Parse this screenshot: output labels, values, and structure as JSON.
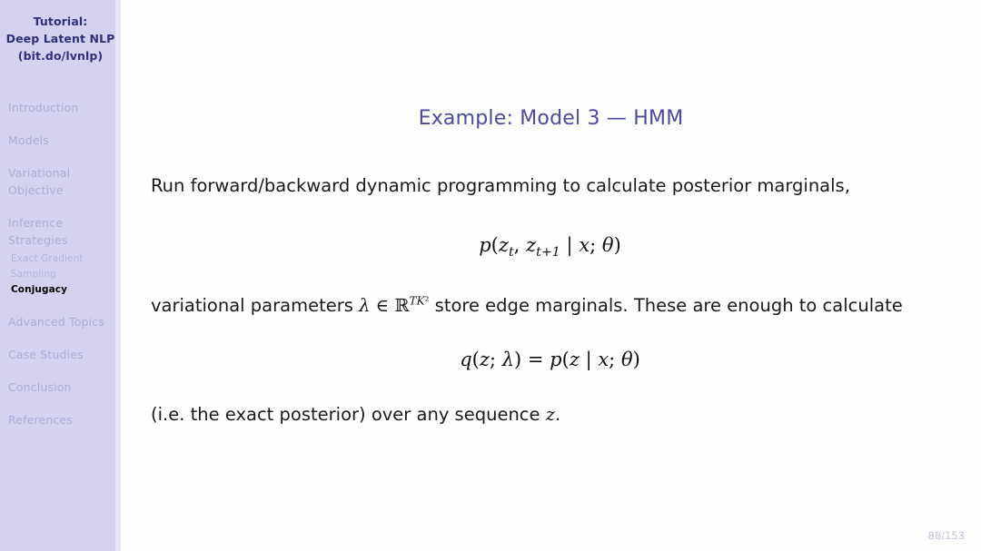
{
  "sidebar": {
    "title_lines": [
      "Tutorial:",
      "Deep Latent NLP",
      "(bit.do/lvnlp)"
    ],
    "sections": [
      {
        "label": "Introduction",
        "lines": [
          "Introduction"
        ],
        "subitems": []
      },
      {
        "label": "Models",
        "lines": [
          "Models"
        ],
        "subitems": []
      },
      {
        "label": "Variational Objective",
        "lines": [
          "Variational",
          "Objective"
        ],
        "subitems": []
      },
      {
        "label": "Inference Strategies",
        "lines": [
          "Inference",
          "Strategies"
        ],
        "subitems": [
          {
            "label": "Exact Gradient",
            "active": false
          },
          {
            "label": "Sampling",
            "active": false
          },
          {
            "label": "Conjugacy",
            "active": true
          }
        ]
      },
      {
        "label": "Advanced Topics",
        "lines": [
          "Advanced Topics"
        ],
        "subitems": []
      },
      {
        "label": "Case Studies",
        "lines": [
          "Case Studies"
        ],
        "subitems": []
      },
      {
        "label": "Conclusion",
        "lines": [
          "Conclusion"
        ],
        "subitems": []
      },
      {
        "label": "References",
        "lines": [
          "References"
        ],
        "subitems": []
      }
    ]
  },
  "slide": {
    "title": "Example: Model 3 — HMM",
    "paragraph_1": "Run forward/backward dynamic programming to calculate posterior marginals,",
    "equation_1": "p(z_t, z_{t+1} | x; θ)",
    "paragraph_2_prefix": "variational parameters ",
    "paragraph_2_math": "λ ∈ ℝ^{TK²}",
    "paragraph_2_suffix": " store edge marginals. These are enough to calculate",
    "equation_2": "q(z; λ) = p(z | x; θ)",
    "paragraph_3": "(i.e. the exact posterior) over any sequence z.",
    "page_number": "88/153"
  },
  "colors": {
    "sidebar_bg": "#d4d2f0",
    "sidebar_edge": "#e7e6f7",
    "sidebar_title": "#2f2f7a",
    "sidebar_item": "#adaad8",
    "sidebar_active": "#000000",
    "slide_title": "#4b4a9c",
    "body_text": "#1a1a1a",
    "page_number": "#c2c0e2",
    "content_bg": "#fefeff"
  }
}
